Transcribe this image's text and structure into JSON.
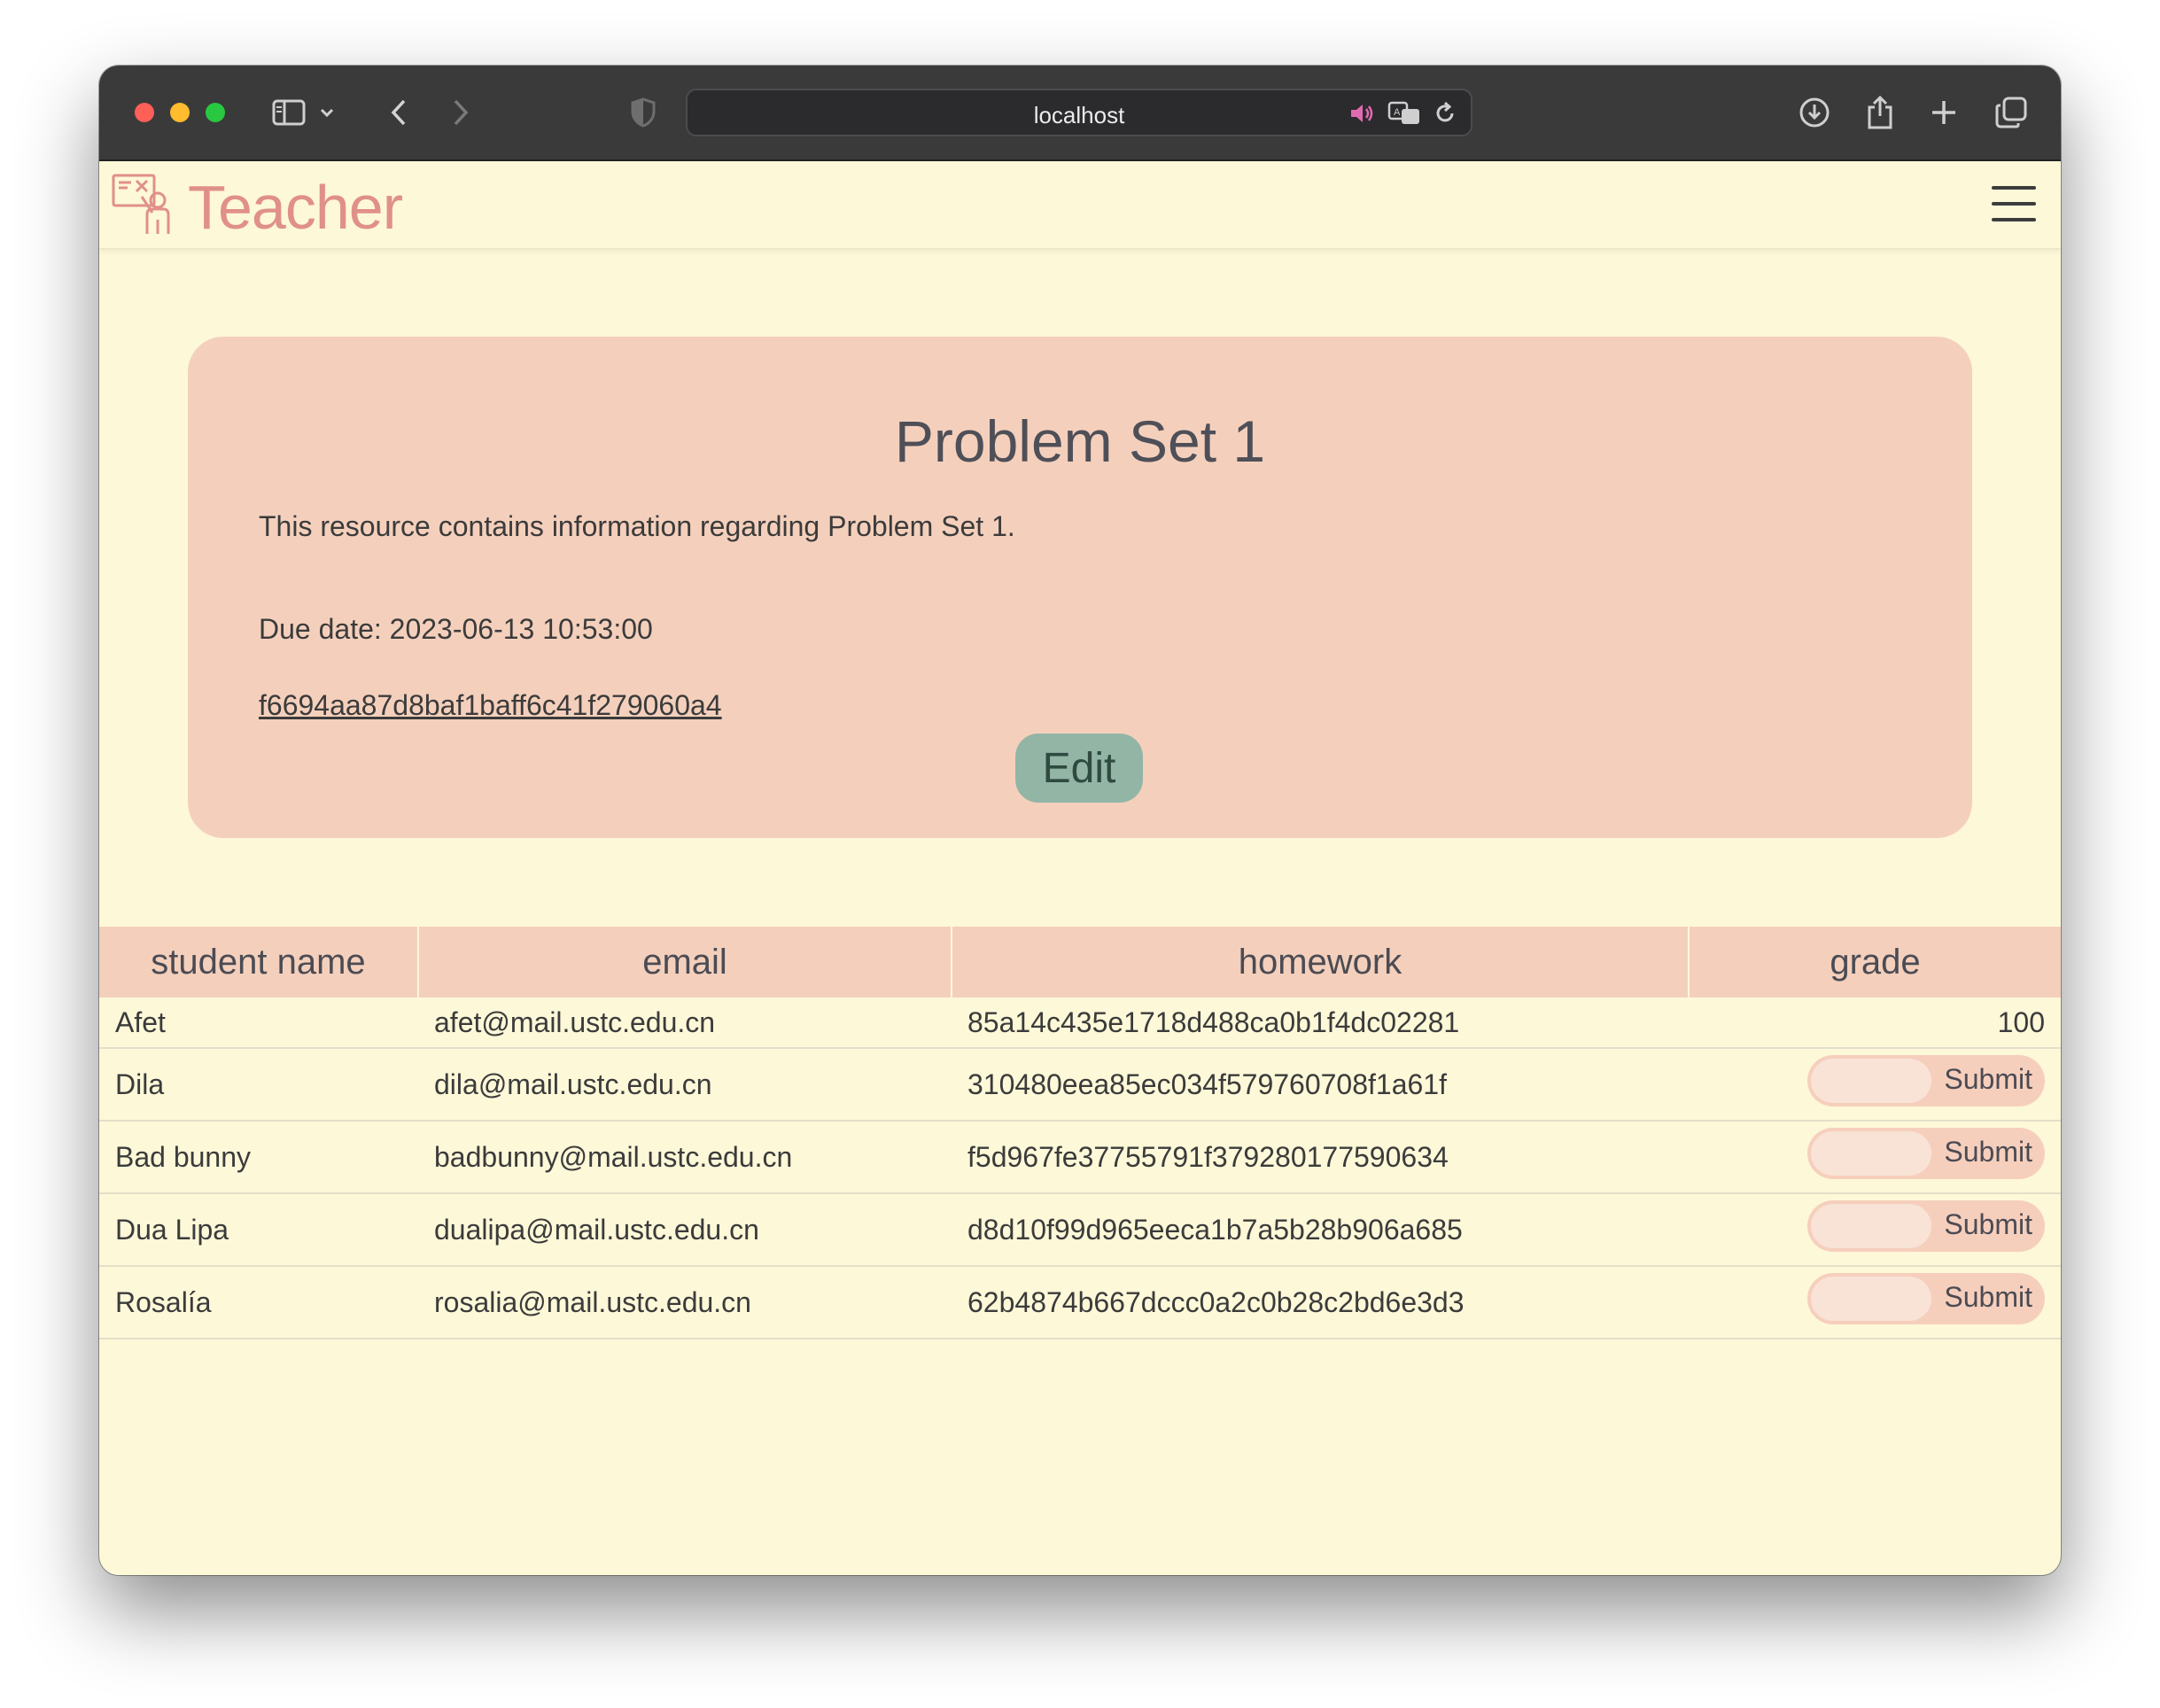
{
  "browser": {
    "url": "localhost"
  },
  "navbar": {
    "brand": "Teacher",
    "accent_color": "#e0908a"
  },
  "resource": {
    "title": "Problem Set 1",
    "description": "This resource contains information regarding Problem Set 1.",
    "due_date": "Due date: 2023-06-13 10:53:00",
    "link_text": "f6694aa87d8baf1baff6c41f279060a4",
    "edit_label": "Edit"
  },
  "table": {
    "headers": [
      "student name",
      "email",
      "homework",
      "grade"
    ],
    "rows": [
      {
        "name": "Afet",
        "email": "afet@mail.ustc.edu.cn",
        "homework": "85a14c435e1718d488ca0b1f4dc02281",
        "grade": "100"
      },
      {
        "name": "Dila",
        "email": "dila@mail.ustc.edu.cn",
        "homework": "310480eea85ec034f579760708f1a61f",
        "submit_label": "Submit"
      },
      {
        "name": "Bad bunny",
        "email": "badbunny@mail.ustc.edu.cn",
        "homework": "f5d967fe37755791f379280177590634",
        "submit_label": "Submit"
      },
      {
        "name": "Dua Lipa",
        "email": "dualipa@mail.ustc.edu.cn",
        "homework": "d8d10f99d965eeca1b7a5b28b906a685",
        "submit_label": "Submit"
      },
      {
        "name": "Rosalía",
        "email": "rosalia@mail.ustc.edu.cn",
        "homework": "62b4874b667dccc0a2c0b28c2bd6e3d3",
        "submit_label": "Submit"
      }
    ]
  },
  "colors": {
    "page_background": "#fdf8d8",
    "card_background": "#f4d0bc",
    "edit_button": "#92b5a5"
  }
}
